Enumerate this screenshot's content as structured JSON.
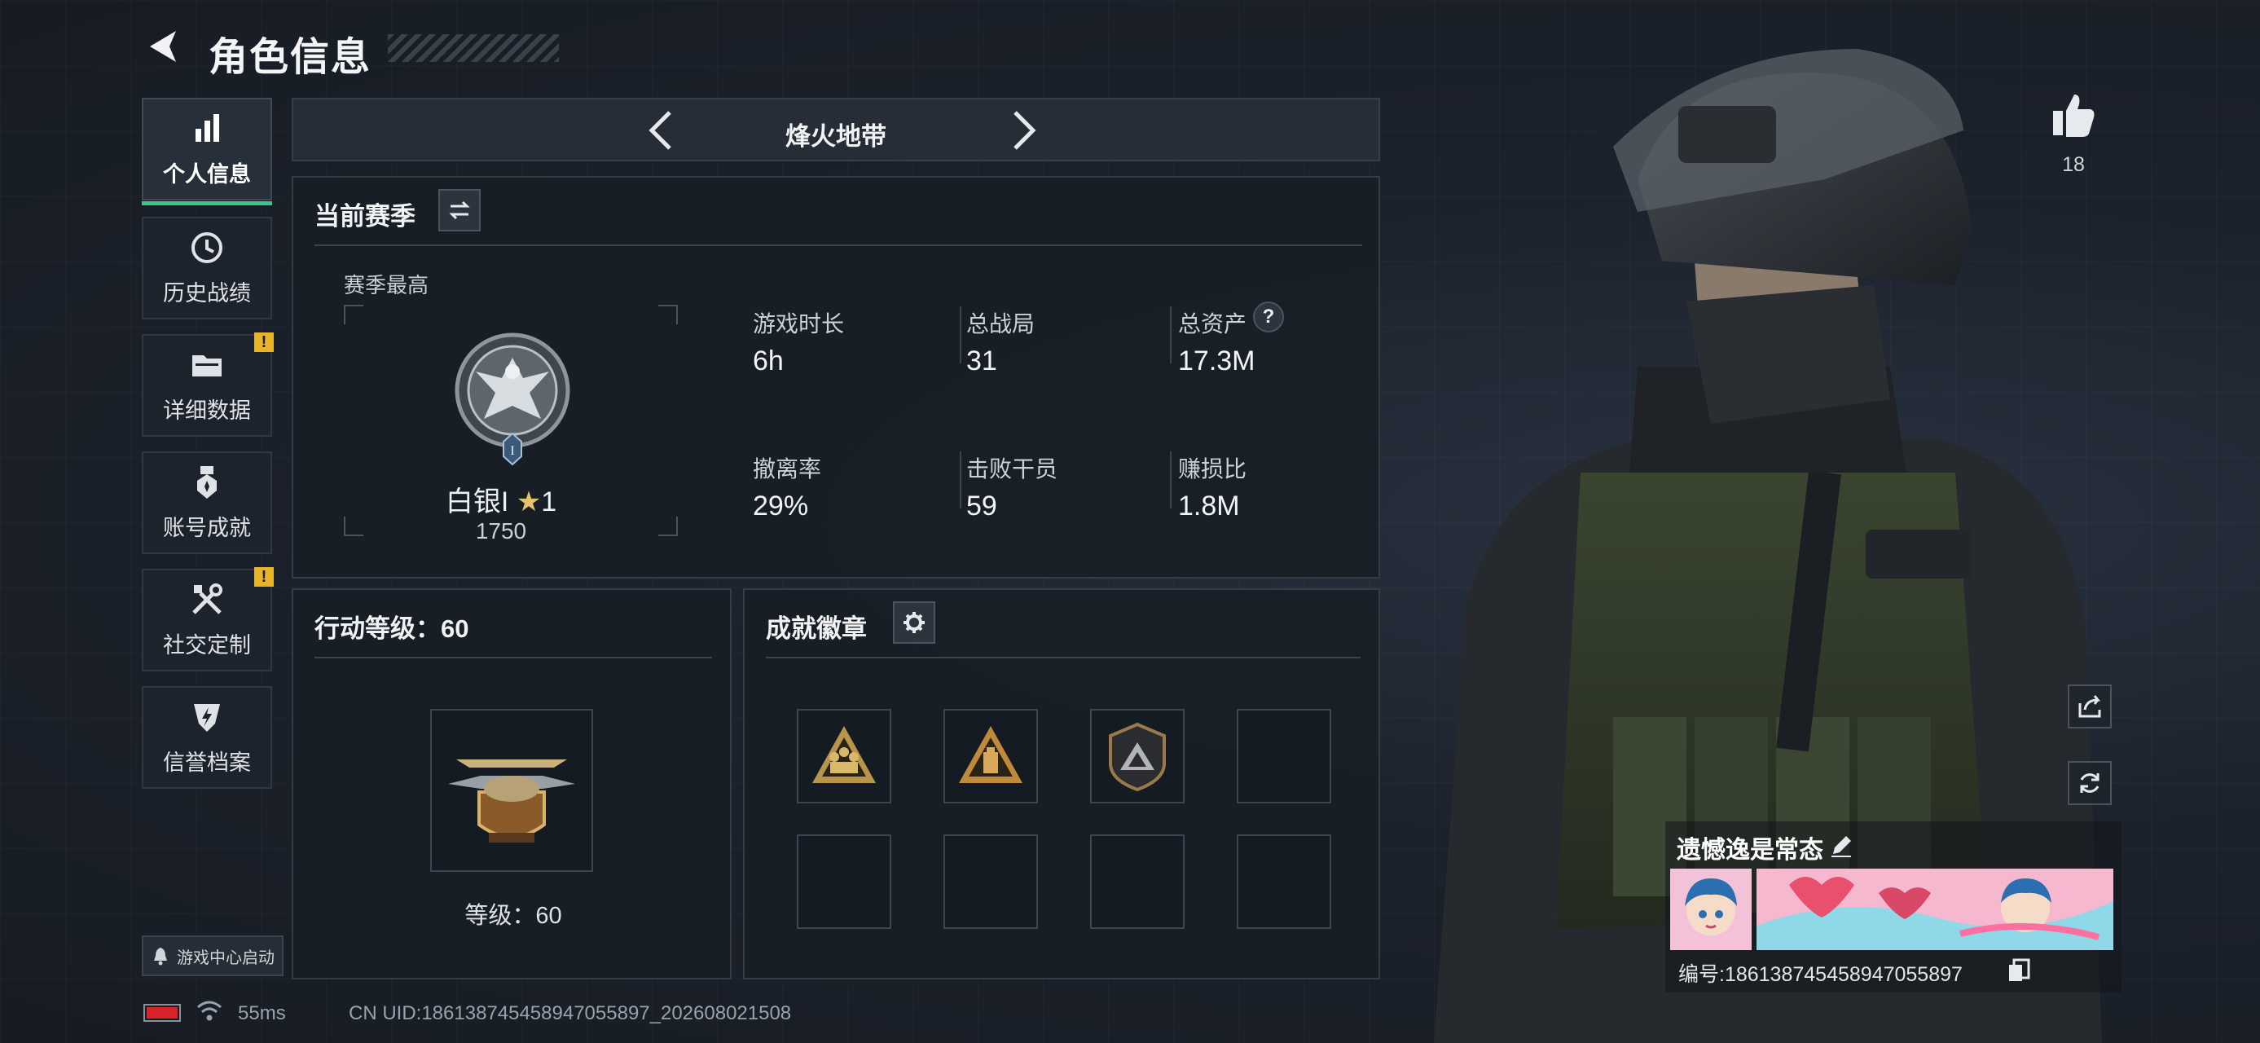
{
  "header": {
    "title": "角色信息"
  },
  "sidebar": {
    "items": [
      {
        "label": "个人信息",
        "icon": "bar-chart-icon",
        "active": true,
        "warning": false
      },
      {
        "label": "历史战绩",
        "icon": "history-clock-icon",
        "active": false,
        "warning": false
      },
      {
        "label": "详细数据",
        "icon": "folder-icon",
        "active": false,
        "warning": true
      },
      {
        "label": "账号成就",
        "icon": "medal-icon",
        "active": false,
        "warning": false
      },
      {
        "label": "社交定制",
        "icon": "tools-icon",
        "active": false,
        "warning": true
      },
      {
        "label": "信誉档案",
        "icon": "shield-bolt-icon",
        "active": false,
        "warning": false
      }
    ],
    "warning_mark": "!",
    "launch_label": "游戏中心启动"
  },
  "mode_selector": {
    "title": "烽火地带"
  },
  "season": {
    "title": "当前赛季",
    "best_label": "赛季最高",
    "rank_name": "白银I",
    "rank_stars": "1",
    "rank_score": "1750",
    "rank_tier_mark": "I",
    "stats": [
      {
        "label": "游戏时长",
        "value": "6h"
      },
      {
        "label": "总战局",
        "value": "31"
      },
      {
        "label": "总资产",
        "value": "17.3M",
        "has_help": true
      },
      {
        "label": "撤离率",
        "value": "29%"
      },
      {
        "label": "击败干员",
        "value": "59"
      },
      {
        "label": "赚损比",
        "value": "1.8M"
      }
    ],
    "help_mark": "?"
  },
  "action_level": {
    "title": "行动等级：60",
    "level_text": "等级：60"
  },
  "achievements": {
    "title": "成就徽章",
    "badges_filled": 3,
    "badges_total": 8
  },
  "profile": {
    "likes": "18",
    "name": "遗憾逸是常态",
    "id_text": "编号:18613874545894705589​7"
  },
  "status_bar": {
    "ping": "55ms",
    "uid": "CN UID:18613874545894705589​7_202608021508"
  },
  "colors": {
    "accent_green": "#38c78b",
    "warning_yellow": "#e8b52a",
    "battery_red": "#d9232a",
    "panel_bg": "#181e26"
  }
}
